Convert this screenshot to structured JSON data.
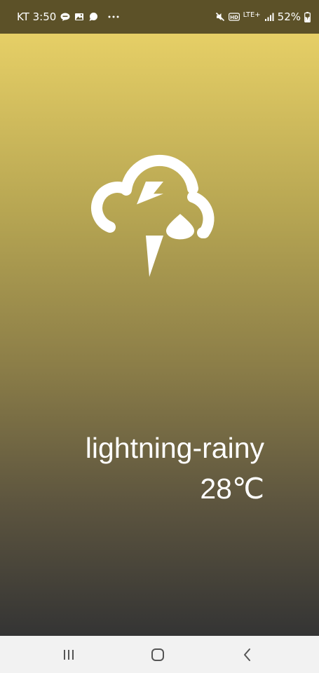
{
  "status_bar": {
    "carrier_time": "KT 3:50",
    "network": "LTE+",
    "battery": "52%",
    "icons": [
      "chat-bubble-icon",
      "image-icon",
      "message-icon",
      "more-icon",
      "mute-icon",
      "hd-icon",
      "signal-icon",
      "battery-charging-icon"
    ]
  },
  "weather": {
    "condition": "lightning-rainy",
    "temperature": "28℃",
    "icon": "weather-lightning-rainy-icon"
  },
  "nav_bar": {
    "icons": [
      "recent-apps-icon",
      "home-icon",
      "back-icon"
    ]
  },
  "colors": {
    "gradient_top": "#e6cf66",
    "gradient_bottom": "#343434",
    "status_bar_bg": "#5c5128",
    "nav_bar_bg": "#f2f2f2",
    "text": "#ffffff"
  }
}
